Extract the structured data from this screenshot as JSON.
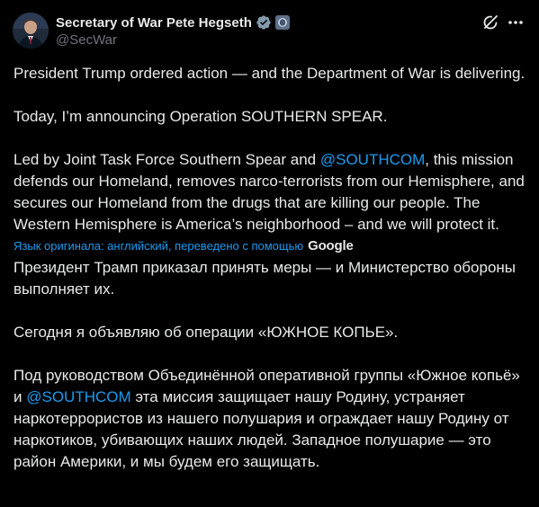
{
  "author": {
    "display_name": "Secretary of War Pete Hegseth",
    "handle": "@SecWar",
    "verified_badge": "verified-check-icon",
    "affiliation_badge": "government-affiliation-icon"
  },
  "toolbar": {
    "grok_icon": "grok-icon",
    "more_icon": "more-options-icon"
  },
  "original": {
    "p1": "President Trump ordered action — and the Department of War is delivering.",
    "p2": "Today, I’m announcing Operation SOUTHERN SPEAR.",
    "p3_before": "Led by Joint Task Force Southern Spear and ",
    "p3_mention": "@SOUTHCOM",
    "p3_after": ", this mission defends our Homeland, removes narco-terrorists from our Hemisphere, and secures our Homeland from the drugs that are killing our people. The Western Hemisphere is America’s neighborhood – and we will protect it."
  },
  "translation_notice": {
    "text": "Язык оригинала: английский, переведено с помощью",
    "provider": "Google"
  },
  "translated": {
    "p1": "Президент Трамп приказал принять меры — и Министерство обороны выполняет их.",
    "p2": "Сегодня я объявляю об операции «ЮЖНОЕ КОПЬЕ».",
    "p3_before": "Под руководством Объединённой оперативной группы «Южное копьё» и ",
    "p3_mention": "@SOUTHCOM",
    "p3_after": " эта миссия защищает нашу Родину, устраняет наркотеррористов из нашего полушария и ограждает нашу Родину от наркотиков, убивающих наших людей. Западное полушарие — это район Америки, и мы будем его защищать."
  },
  "colors": {
    "background": "#000000",
    "text": "#e7e9ea",
    "secondary": "#71767b",
    "link": "#1d9bf0"
  }
}
